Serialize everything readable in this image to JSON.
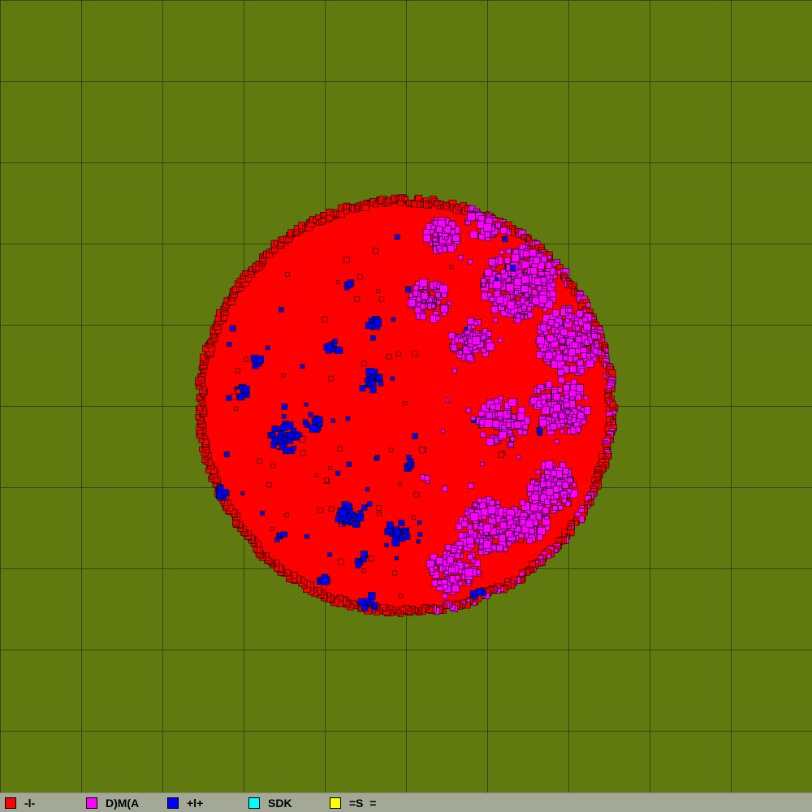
{
  "map": {
    "background_color": "#617a0f",
    "grid_color": "#2f4a10",
    "outline_color": "#000000"
  },
  "legend": {
    "items": [
      {
        "label": "-l-",
        "color": "#ff0000"
      },
      {
        "label": "D)M(A",
        "color": "#ff00ff"
      },
      {
        "label": "+l+",
        "color": "#0000ff"
      },
      {
        "label": "SDK",
        "color": "#00ffff"
      },
      {
        "label": "=S  =",
        "color": "#ffff00"
      }
    ]
  }
}
